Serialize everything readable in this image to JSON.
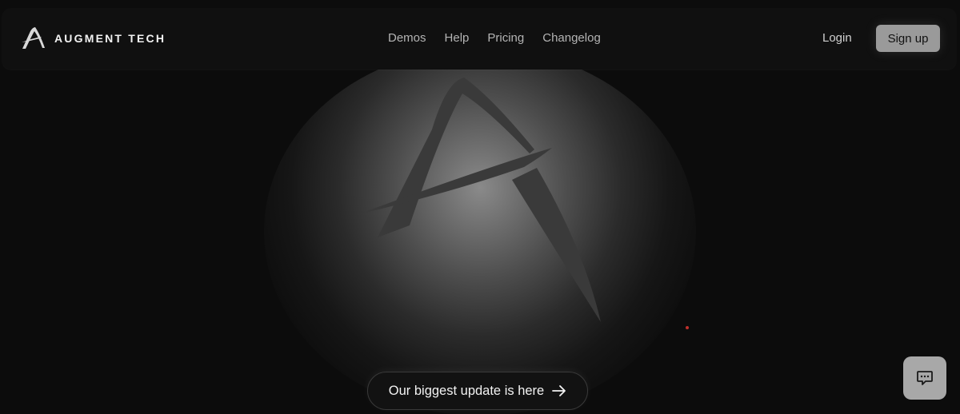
{
  "brand": {
    "name": "AUGMENT TECH",
    "logo_icon": "augment-a-logo-icon"
  },
  "nav": {
    "links": [
      "Demos",
      "Help",
      "Pricing",
      "Changelog"
    ],
    "login_label": "Login",
    "signup_label": "Sign up"
  },
  "hero": {
    "mark_icon": "augment-a-logo-icon",
    "cta_label": "Our biggest update is here",
    "cta_icon": "arrow-right-icon"
  },
  "chat": {
    "icon": "chat-bubble-icon"
  },
  "colors": {
    "background": "#0c0c0c",
    "navbar": "#101010",
    "signup_button": "#9a9a9a",
    "chat_button": "#a8a8a8",
    "accent_dot": "#c0302c"
  }
}
